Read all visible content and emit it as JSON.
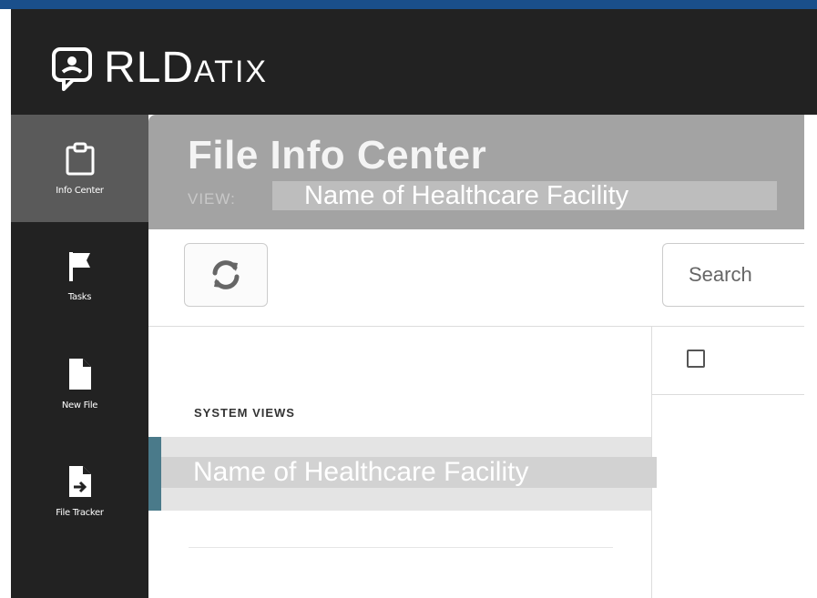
{
  "brand": {
    "logo_letters": "RLD",
    "logo_small": "ATIX",
    "colors": {
      "header": "#222222",
      "accent_blue": "#1a4f8b",
      "selected_accent": "#4a7a8a"
    }
  },
  "sidebar": {
    "items": [
      {
        "label": "Info Center",
        "icon": "clipboard-icon",
        "active": true
      },
      {
        "label": "Tasks",
        "icon": "flag-icon",
        "active": false
      },
      {
        "label": "New File",
        "icon": "file-icon",
        "active": false
      },
      {
        "label": "File Tracker",
        "icon": "file-arrow-icon",
        "active": false
      }
    ]
  },
  "page": {
    "title": "File Info Center",
    "view_label": "VIEW:",
    "view_value": "Name of Healthcare Facility"
  },
  "toolbar": {
    "refresh_icon": "refresh-icon",
    "search_placeholder": "Search"
  },
  "left_panel": {
    "section_title": "SYSTEM VIEWS",
    "views": [
      {
        "label": "Name of Healthcare Facility",
        "selected": true
      }
    ]
  },
  "grid": {
    "select_all_checked": false
  }
}
